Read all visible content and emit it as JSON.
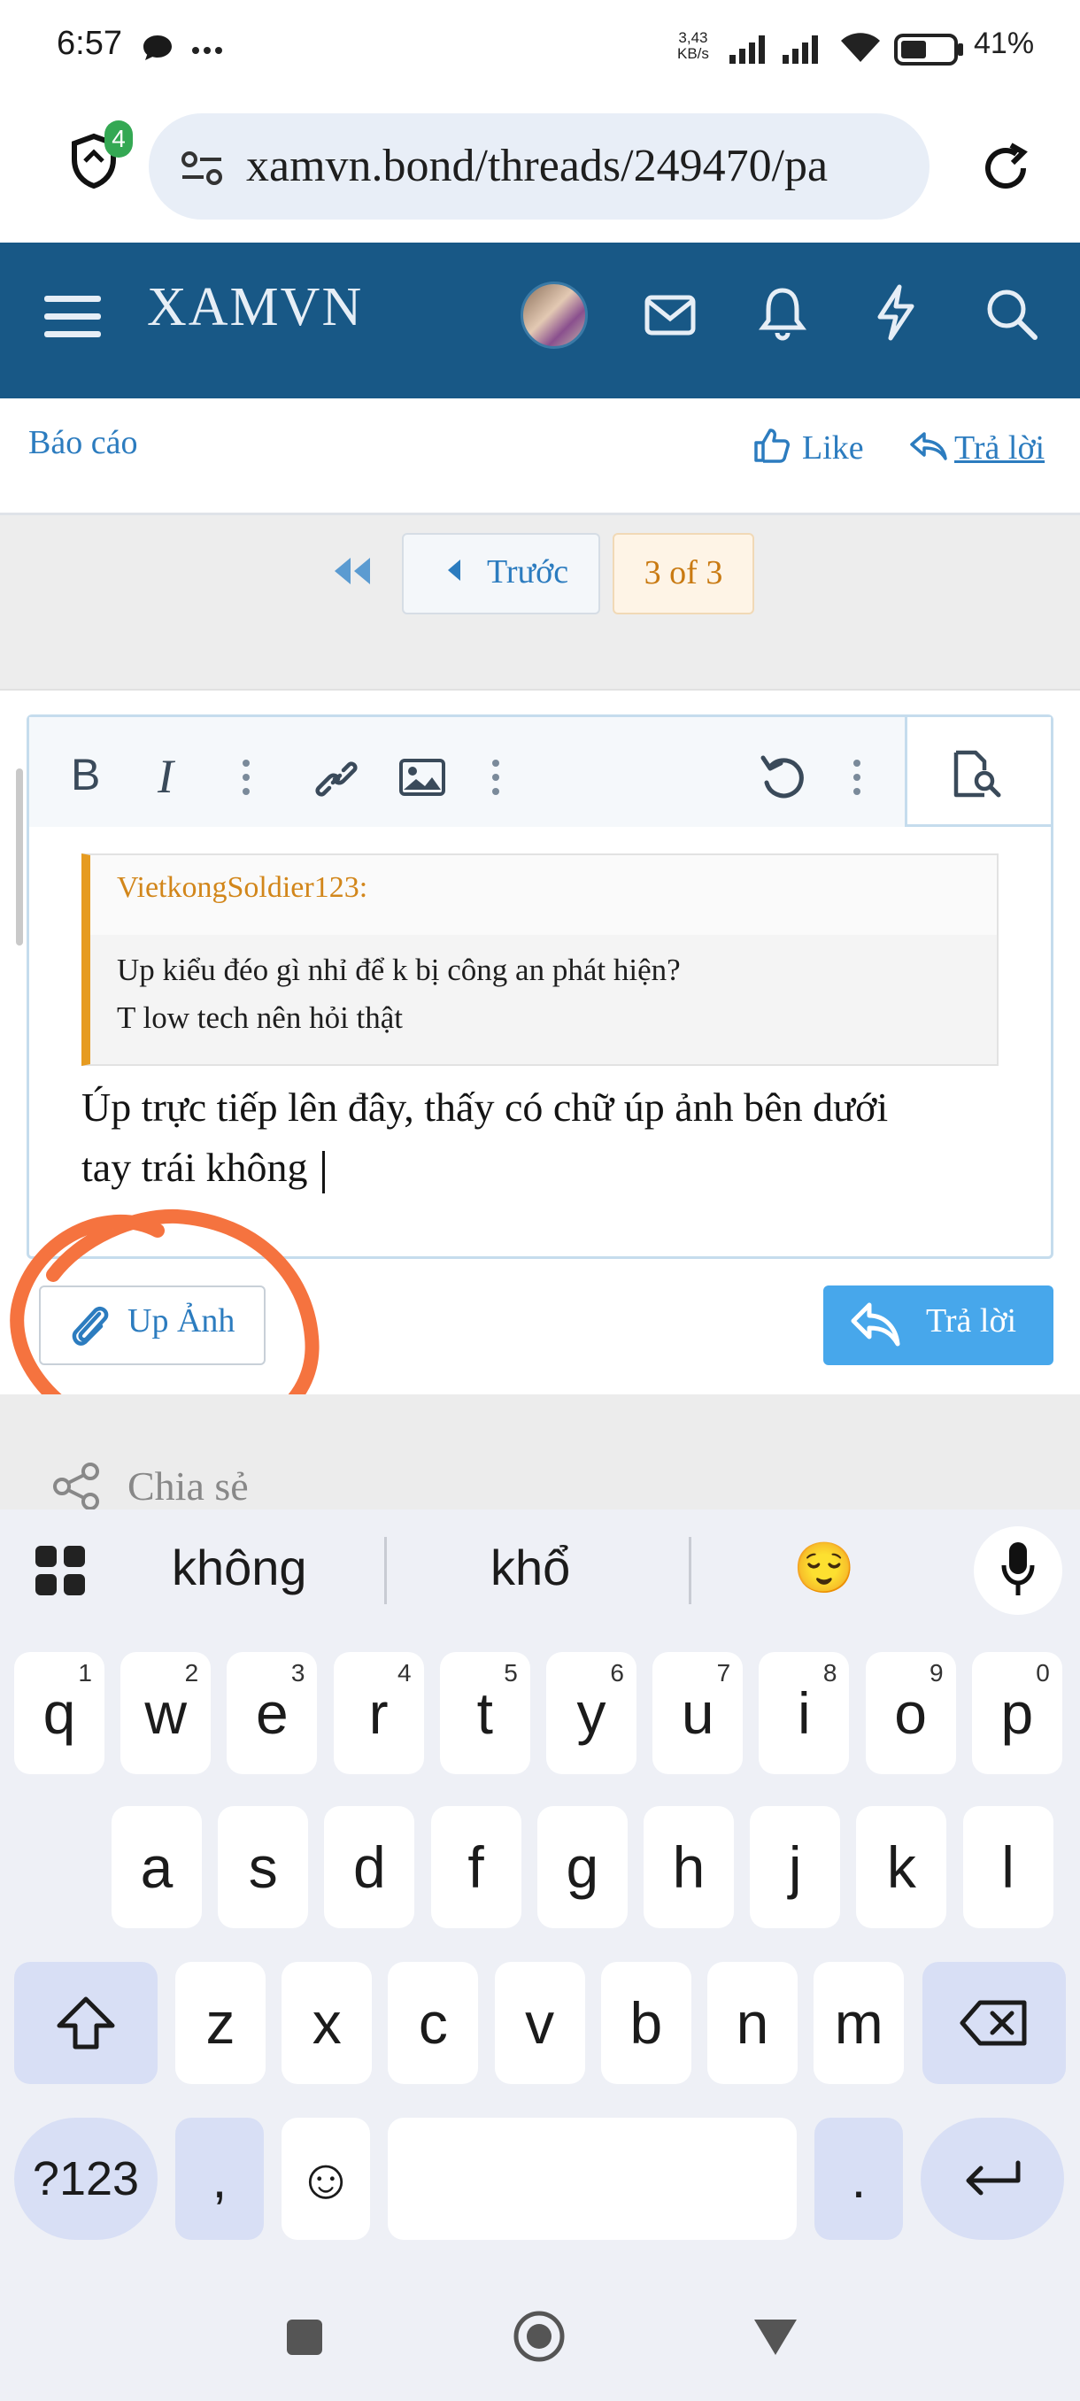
{
  "status_bar": {
    "time": "6:57",
    "net_speed_value": "3,43",
    "net_speed_unit": "KB/s",
    "battery": "41%"
  },
  "browser": {
    "url": "xamvn.bond/threads/249470/pa",
    "shield_badge": "4"
  },
  "header": {
    "site_title": "XAMVN"
  },
  "post_actions": {
    "report": "Báo cáo",
    "like": "Like",
    "reply": "Trả lời"
  },
  "pagination": {
    "prev": "Trước",
    "current": "3 of 3"
  },
  "editor": {
    "quote_author": "VietkongSoldier123:",
    "quote_lines": [
      "Up kiểu đéo gì nhỉ để k bị công an phát hiện?",
      "T low tech nên hỏi thật"
    ],
    "message_lines": [
      "Úp trực tiếp lên đây, thấy có chữ úp ảnh bên dưới",
      "tay trái không"
    ],
    "upload_label": "Up Ảnh",
    "submit_label": "Trả lời",
    "annotation_color": "#f5733f"
  },
  "share": {
    "label": "Chia sẻ"
  },
  "keyboard": {
    "suggestions": [
      "không",
      "khổ",
      "😌"
    ],
    "row1": [
      "q",
      "w",
      "e",
      "r",
      "t",
      "y",
      "u",
      "i",
      "o",
      "p"
    ],
    "row1_numbers": [
      "1",
      "2",
      "3",
      "4",
      "5",
      "6",
      "7",
      "8",
      "9",
      "0"
    ],
    "row2": [
      "a",
      "s",
      "d",
      "f",
      "g",
      "h",
      "j",
      "k",
      "l"
    ],
    "row3": [
      "z",
      "x",
      "c",
      "v",
      "b",
      "n",
      "m"
    ],
    "symbols_key": "?123",
    "comma_key": ",",
    "period_key": ".",
    "emoji_key": "☺"
  },
  "colors": {
    "header_bg": "#185886",
    "link": "#2c7cbf",
    "reply_button": "#47a7eb",
    "quote_accent": "#e69b20"
  }
}
